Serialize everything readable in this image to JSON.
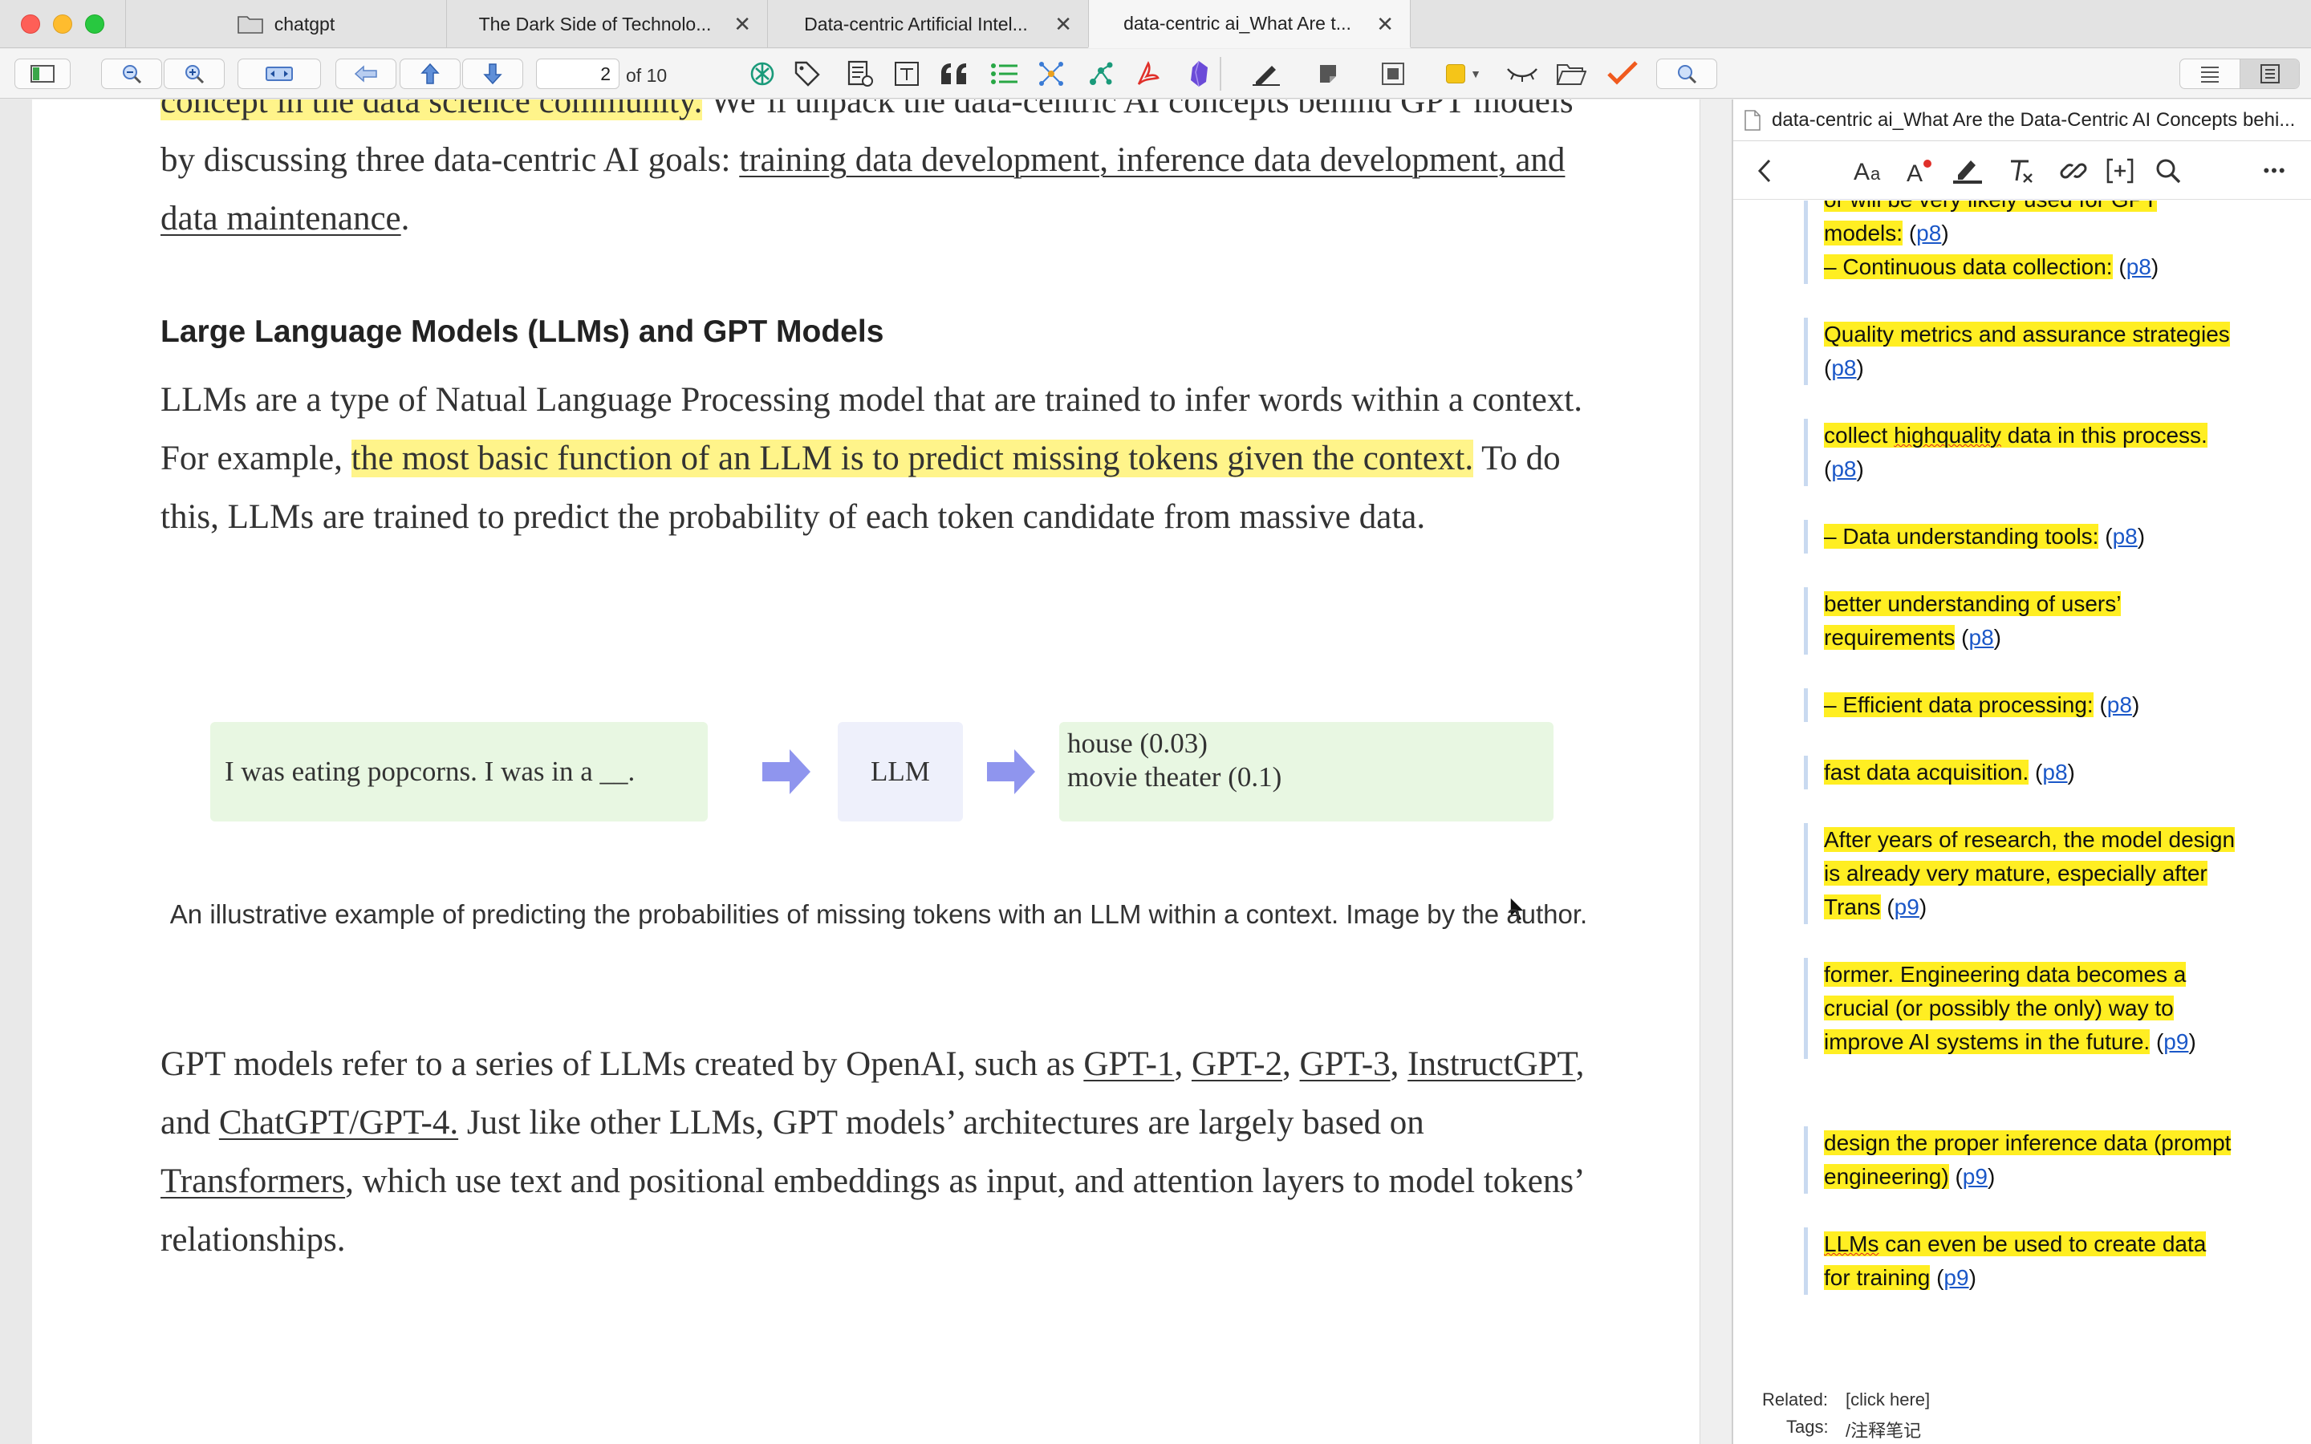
{
  "tabs": [
    {
      "label": "chatgpt",
      "has_folder": true
    },
    {
      "label": "The Dark Side of Technolo...",
      "close": "✕"
    },
    {
      "label": "Data-centric Artificial Intel...",
      "close": "✕"
    },
    {
      "label": "data-centric ai_What Are t...",
      "close": "✕"
    }
  ],
  "toolbar": {
    "page_number": "2",
    "page_of": "of 10"
  },
  "document": {
    "para1_hl": "concept in the data science community.",
    "para1_a": " We’ll unpack the data-centric AI concepts behind GPT models by discussing three data-centric AI goals: ",
    "para1_link": "training data development, inference data development, and data maintenance",
    "para1_end": ".",
    "heading": "Large Language Models (LLMs) and GPT Models",
    "para2_a": "LLMs are a type of Natual Language Processing model that are trained to infer words within a context. For example, ",
    "para2_hl": "the most basic function of an LLM is to predict missing tokens given the context.",
    "para2_b": " To do this, LLMs are trained to predict the probability of each token candidate from massive data.",
    "figure": {
      "input": "I was eating popcorns. I was in a __.",
      "model": "LLM",
      "out1": "house (0.03)",
      "out2": "movie theater (0.1)"
    },
    "caption": "An illustrative example of predicting the probabilities of missing tokens with an LLM within a context. Image by the author.",
    "para3": {
      "t1": "GPT models refer to a series of LLMs created by OpenAI, such as ",
      "l1": "GPT-1",
      "t2": ", ",
      "l2": "GPT-2",
      "t3": ", ",
      "l3": "GPT-3",
      "t4": ", ",
      "l4": "InstructGPT",
      "t5": ", and ",
      "l5": "ChatGPT/GPT-4.",
      "t6": " Just like other LLMs, GPT models’ architectures are largely based on ",
      "l6": "Transformers",
      "t7": ", which use text and positional embeddings as input, and attention layers to model tokens’ relationships."
    }
  },
  "right_pane": {
    "title": "data-centric ai_What Are the Data-Centric AI Concepts behi...",
    "more": "•••",
    "notes": [
      {
        "text_partial": "or will be very likely used for GPT models:",
        "page": "p8"
      },
      {
        "text": "– Continuous data collection:",
        "page": "p8"
      },
      {
        "text": "Quality metrics and assurance strategies",
        "page": "p8"
      },
      {
        "text_a": "collect ",
        "text_sq": "highquality",
        "text_b": " data in this process.",
        "page": "p8"
      },
      {
        "text": "– Data understanding tools:",
        "page": "p8"
      },
      {
        "text": "better understanding of users’ requirements",
        "page": "p8"
      },
      {
        "text": "– Efficient data processing:",
        "page": "p8"
      },
      {
        "text": "fast data acquisition.",
        "page": "p8"
      },
      {
        "text": "After years of research, the model design is already very mature, especially after Trans",
        "page": "p9"
      },
      {
        "text": "former. Engineering data becomes a crucial (or possibly the only) way to improve AI systems in the future.",
        "page": "p9"
      },
      {
        "text": "design the proper inference data (prompt engineering)",
        "page": "p9"
      },
      {
        "text_sq": "LLMs",
        "text_b": " can even be used to create data for training",
        "page": "p9"
      }
    ],
    "related_label": "Related:",
    "related_value": "[click here]",
    "tags_label": "Tags:",
    "tags_value": "/注释笔记"
  },
  "colors": {
    "doc_highlight": "#fff48a",
    "note_highlight": "#ffee22",
    "link": "#1a57c8",
    "figure_green": "#e8f7e2",
    "figure_blue": "#eef0fb",
    "arrow": "#8f95ee"
  }
}
